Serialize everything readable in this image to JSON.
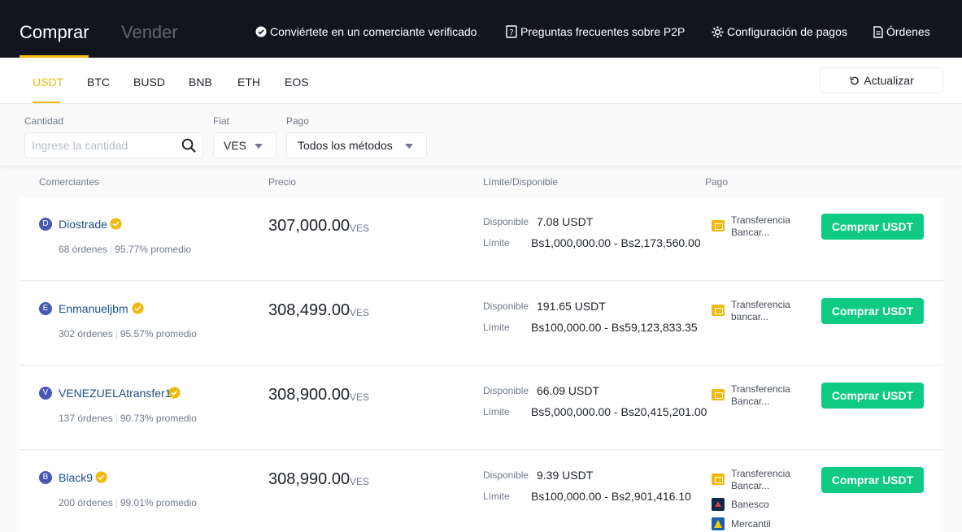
{
  "header": {
    "mode_tabs": [
      {
        "label": "Comprar",
        "active": true
      },
      {
        "label": "Vender",
        "active": false
      }
    ],
    "links": [
      {
        "label": "Conviértete en un comerciante verificado",
        "icon": "check-badge-icon"
      },
      {
        "label": "Preguntas frecuentes sobre P2P",
        "icon": "question-icon"
      },
      {
        "label": "Configuración de pagos",
        "icon": "gear-icon"
      },
      {
        "label": "Órdenes",
        "icon": "document-icon"
      }
    ]
  },
  "coins": {
    "tabs": [
      "USDT",
      "BTC",
      "BUSD",
      "BNB",
      "ETH",
      "EOS"
    ],
    "active": "USDT",
    "refresh_label": "Actualizar"
  },
  "filters": {
    "amount_label": "Cantidad",
    "amount_placeholder": "Ingrese la cantidad",
    "fiat_label": "Fiat",
    "fiat_value": "VES",
    "payment_label": "Pago",
    "payment_value": "Todos los métodos"
  },
  "columns": [
    "Comerciantes",
    "Precio",
    "Límite/Disponible",
    "Pago"
  ],
  "labels": {
    "available": "Disponible",
    "limit": "Límite"
  },
  "rows": [
    {
      "initial": "D",
      "name": "Diostrade",
      "orders": "68 órdenes",
      "completion": "95.77% promedio",
      "price": "307,000.00",
      "currency": "VES",
      "available": "7.08 USDT",
      "limit": "Bs1,000,000.00 - Bs2,173,560.00",
      "payments": [
        {
          "line1": "Transferencia",
          "line2": "Bancar..."
        }
      ],
      "button": "Comprar USDT"
    },
    {
      "initial": "E",
      "name": "Enmanueljbm",
      "orders": "302 órdenes",
      "completion": "95.57% promedio",
      "price": "308,499.00",
      "currency": "VES",
      "available": "191.65 USDT",
      "limit": "Bs100,000.00 - Bs59,123,833.35",
      "payments": [
        {
          "line1": "Transferencia",
          "line2": "bancar..."
        }
      ],
      "button": "Comprar USDT"
    },
    {
      "initial": "V",
      "name": "VENEZUELAtransfer1",
      "orders": "137 órdenes",
      "completion": "90.73% promedio",
      "price": "308,900.00",
      "currency": "VES",
      "available": "66.09 USDT",
      "limit": "Bs5,000,000.00 - Bs20,415,201.00",
      "payments": [
        {
          "line1": "Transferencia",
          "line2": "Bancar..."
        }
      ],
      "button": "Comprar USDT"
    },
    {
      "initial": "B",
      "name": "Black9",
      "orders": "200 órdenes",
      "completion": "99.01% promedio",
      "price": "308,990.00",
      "currency": "VES",
      "available": "9.39 USDT",
      "limit": "Bs100,000.00 - Bs2,901,416.10",
      "payments": [
        {
          "line1": "Transferencia",
          "line2": "Bancar..."
        },
        {
          "line1": "Banesco"
        },
        {
          "line1": "Mercantil"
        }
      ],
      "button": "Comprar USDT"
    }
  ],
  "colors": {
    "accent": "#f0b90b",
    "buy_green": "#0ecb81",
    "topbar": "#12161c",
    "merchant_link": "#1e4f86"
  }
}
